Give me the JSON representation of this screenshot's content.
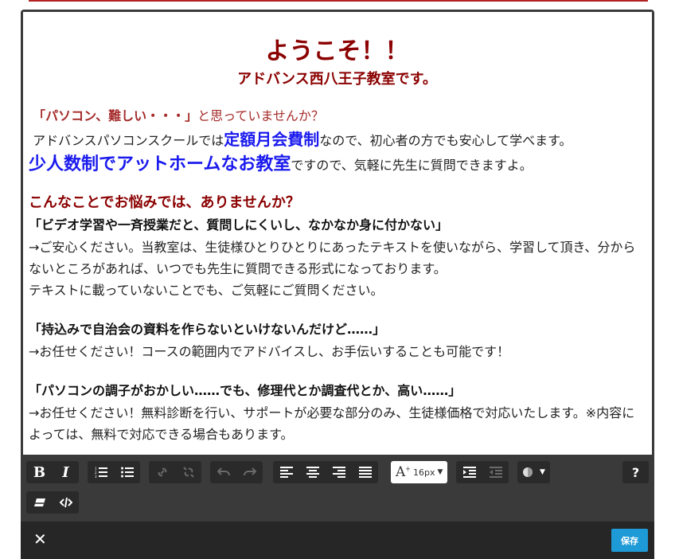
{
  "content": {
    "title": "ようこそ！！",
    "subtitle": "アドバンス西八王子教室です。",
    "q1_bold": "「パソコン、難しい・・・」",
    "q1_rest": "と思っていませんか？",
    "line2_a": "アドバンスパソコンスクールでは",
    "line2_b": "定額月会費制",
    "line2_c": "なので、初心者の方でも安心して学べます。",
    "line3_a": "少人数制でアットホームなお教室",
    "line3_b": "ですので、気軽に先生に質問できますよ。",
    "section": "こんなことでお悩みでは、ありませんか？",
    "item1_head": "「ビデオ学習や一斉授業だと、質問しにくいし、なかなか身に付かない」",
    "item1_body": "→ご安心ください。当教室は、生徒様ひとりひとりにあったテキストを使いながら、学習して頂き、分からないところがあれば、いつでも先生に質問できる形式になっております。",
    "item1_body2": "テキストに載っていないことでも、ご気軽にご質問ください。",
    "item2_head": "「持込みで自治会の資料を作らないといけないんだけど……」",
    "item2_body": "→お任せください！コースの範囲内でアドバイスし、お手伝いすることも可能です！",
    "item3_head": "「パソコンの調子がおかしい……でも、修理代とか調査代とか、高い……」",
    "item3_body": "→お任せください！無料診断を行い、サポートが必要な部分のみ、生徒様価格で対応いたします。※内容によっては、無料で対応できる場合もあります。"
  },
  "toolbar": {
    "font_size": "16px",
    "help": "?"
  },
  "footer": {
    "close": "✕",
    "save": "保存"
  }
}
